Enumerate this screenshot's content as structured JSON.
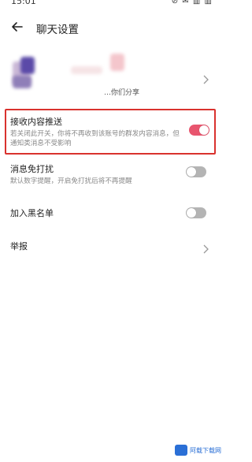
{
  "status_bar": {
    "time": "15:01",
    "icons": "⊘ ✉ ▥ ▥"
  },
  "header": {
    "title": "聊天设置",
    "back_icon": "back-arrow-icon"
  },
  "profile": {
    "subtitle": "…你们分享",
    "chevron_icon": "chevron-right-icon"
  },
  "settings": [
    {
      "title": "接收内容推送",
      "description": "若关闭此开关，你将不再收到该账号的群发内容消息，但通知类消息不受影响",
      "toggle_on": true
    },
    {
      "title": "消息免打扰",
      "description": "默认数字提醒，开启免打扰后将不再提醒",
      "toggle_on": false
    },
    {
      "title": "加入黑名单",
      "toggle_on": false
    },
    {
      "title": "举报",
      "chevron_icon": "chevron-right-icon"
    }
  ],
  "watermark": {
    "text": "阿载下载网"
  },
  "colors": {
    "toggle_on": "#e8556e",
    "toggle_off": "#b4b4b4",
    "highlight_border": "#d9322e"
  }
}
